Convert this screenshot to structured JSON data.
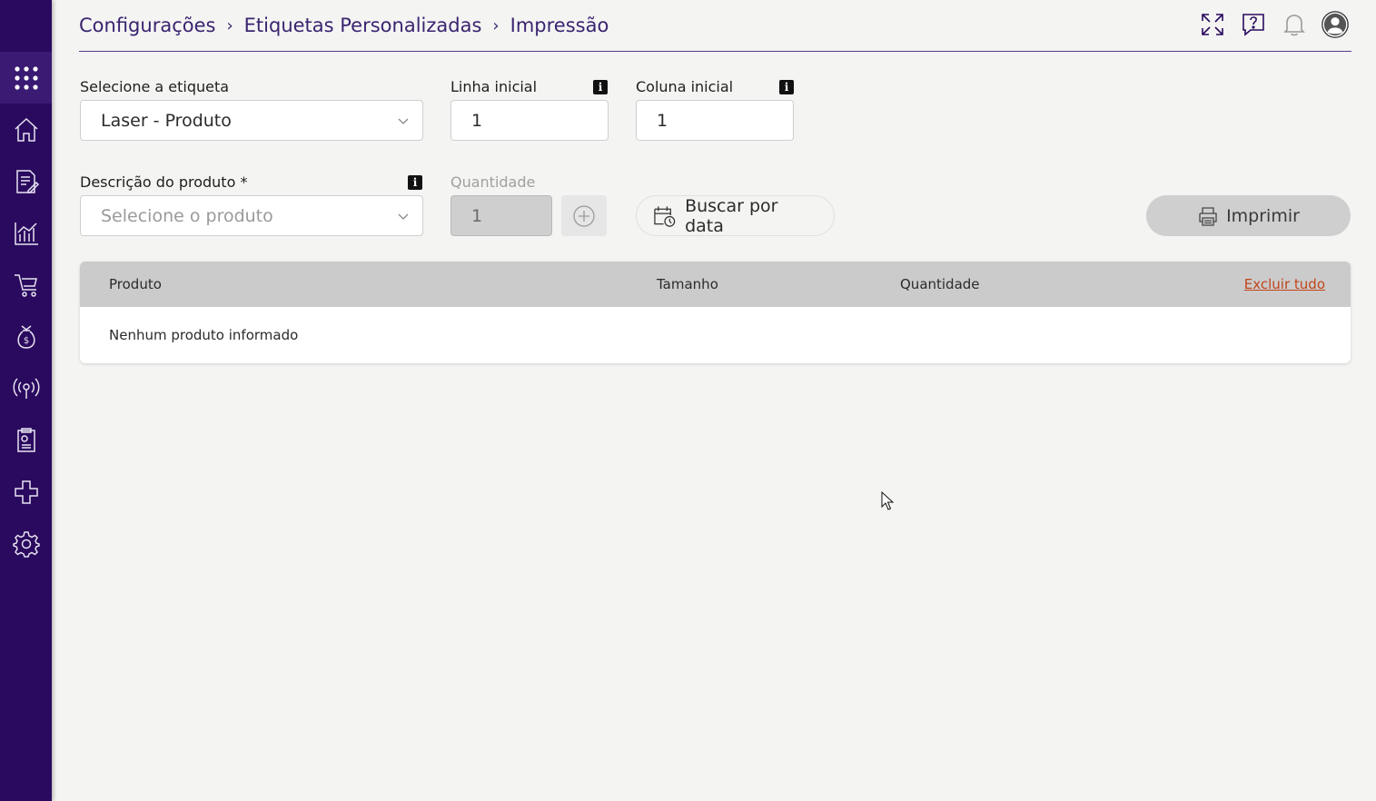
{
  "breadcrumb": [
    "Configurações",
    "Etiquetas Personalizadas",
    "Impressão"
  ],
  "form": {
    "etiqueta_label": "Selecione a etiqueta",
    "etiqueta_value": "Laser - Produto",
    "linha_label": "Linha inicial",
    "linha_value": "1",
    "coluna_label": "Coluna inicial",
    "coluna_value": "1",
    "produto_label": "Descrição do produto *",
    "produto_placeholder": "Selecione o produto",
    "quantidade_label": "Quantidade",
    "quantidade_value": "1",
    "buscar_label": "Buscar por data",
    "imprimir_label": "Imprimir",
    "info_glyph": "i"
  },
  "table": {
    "headers": [
      "Produto",
      "Tamanho",
      "Quantidade"
    ],
    "excluir_label": "Excluir tudo",
    "empty_message": "Nenhum produto informado"
  },
  "icons": {
    "sidebar": [
      "apps-grid-icon",
      "home-icon",
      "document-edit-icon",
      "bar-chart-icon",
      "cart-icon",
      "money-bag-icon",
      "broadcast-icon",
      "report-icon",
      "integration-icon",
      "settings-gear-icon"
    ],
    "header": [
      "fullscreen-icon",
      "help-chat-icon",
      "bell-icon",
      "user-avatar-icon"
    ]
  },
  "colors": {
    "sidebar_bg": "#2a0a5e",
    "accent": "#3a2470",
    "link": "#c2451b"
  }
}
